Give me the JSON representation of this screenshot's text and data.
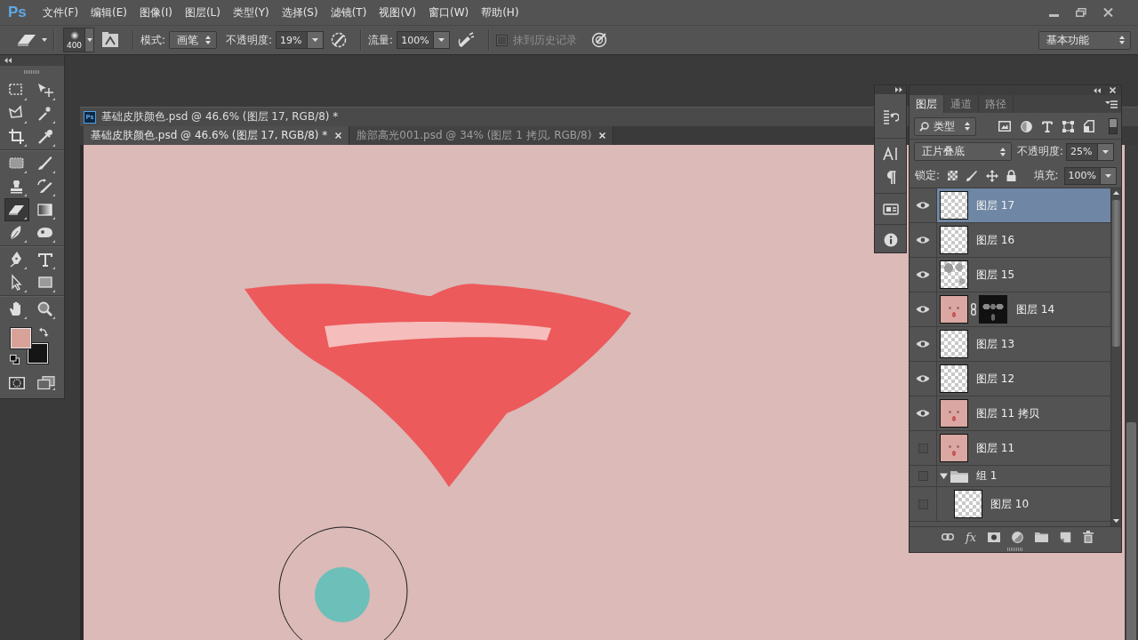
{
  "menu_bar": {
    "logo": "Ps",
    "items": [
      "文件(F)",
      "编辑(E)",
      "图像(I)",
      "图层(L)",
      "类型(Y)",
      "选择(S)",
      "滤镜(T)",
      "视图(V)",
      "窗口(W)",
      "帮助(H)"
    ]
  },
  "options_bar": {
    "brush_size": "400",
    "mode": {
      "label": "模式:",
      "value": "画笔"
    },
    "opacity": {
      "label": "不透明度:",
      "value": "19%"
    },
    "flow": {
      "label": "流量:",
      "value": "100%"
    },
    "erase_to_history": {
      "label": "抹到历史记录",
      "checked": false,
      "disabled": true
    },
    "workspace": "基本功能"
  },
  "tool_groups": [
    {
      "tools": [
        {
          "kind": "marquee",
          "selected": false
        },
        {
          "kind": "move",
          "selected": false
        },
        {
          "kind": "lasso",
          "selected": false
        },
        {
          "kind": "magic_wand",
          "selected": false
        },
        {
          "kind": "crop",
          "selected": false
        },
        {
          "kind": "eyedropper",
          "selected": false
        }
      ]
    },
    {
      "tools": [
        {
          "kind": "healing",
          "selected": false
        },
        {
          "kind": "brush",
          "selected": false
        },
        {
          "kind": "stamp",
          "selected": false
        },
        {
          "kind": "history_brush",
          "selected": false
        },
        {
          "kind": "eraser",
          "selected": true
        },
        {
          "kind": "gradient",
          "selected": false
        },
        {
          "kind": "blur",
          "selected": false
        },
        {
          "kind": "sponge",
          "selected": false
        }
      ]
    },
    {
      "tools": [
        {
          "kind": "pen",
          "selected": false
        },
        {
          "kind": "type",
          "selected": false
        },
        {
          "kind": "path_select",
          "selected": false
        },
        {
          "kind": "shape",
          "selected": false
        }
      ]
    },
    {
      "tools": [
        {
          "kind": "hand",
          "selected": false
        },
        {
          "kind": "zoom",
          "selected": false
        }
      ]
    }
  ],
  "swatches": [
    {
      "kind": "background",
      "color": "#151515"
    },
    {
      "kind": "foreground",
      "color": "#d9a299"
    }
  ],
  "document": {
    "icon": "Ps",
    "title": "基础皮肤颜色.psd @ 46.6% (图层 17, RGB/8) *",
    "tabs": [
      {
        "label": "基础皮肤颜色.psd @ 46.6% (图层 17, RGB/8) *",
        "selected": true
      },
      {
        "label": "脸部高光001.psd @ 34% (图层 1 拷贝, RGB/8)",
        "selected": false
      }
    ]
  },
  "layers_panel": {
    "tabs": [
      {
        "label": "图层",
        "selected": true
      },
      {
        "label": "通道",
        "selected": false
      },
      {
        "label": "路径",
        "selected": false
      }
    ],
    "filter": "类型",
    "filter_on": false,
    "blend_mode": "正片叠底",
    "opacity": {
      "label": "不透明度:",
      "value": "25%"
    },
    "lock_label": "锁定:",
    "fill": {
      "label": "填充:",
      "value": "100%"
    },
    "style_button": "fx",
    "layers": [
      {
        "kind": "layer",
        "name": "图层 17",
        "visible": true,
        "selected": true,
        "thumbnail": {
          "kind": "empty"
        }
      },
      {
        "kind": "layer",
        "name": "图层 16",
        "visible": true,
        "selected": false,
        "thumbnail": {
          "kind": "empty"
        }
      },
      {
        "kind": "layer",
        "name": "图层 15",
        "visible": true,
        "selected": false,
        "thumbnail": {
          "kind": "sparse"
        }
      },
      {
        "kind": "masked",
        "name": "图层 14",
        "visible": true,
        "selected": false,
        "thumbnail": {
          "kind": "face"
        }
      },
      {
        "kind": "layer",
        "name": "图层 13",
        "visible": true,
        "selected": false,
        "thumbnail": {
          "kind": "empty"
        }
      },
      {
        "kind": "layer",
        "name": "图层 12",
        "visible": true,
        "selected": false,
        "thumbnail": {
          "kind": "empty"
        }
      },
      {
        "kind": "layer",
        "name": "图层 11 拷贝",
        "visible": true,
        "selected": false,
        "thumbnail": {
          "kind": "face"
        }
      },
      {
        "kind": "layer",
        "name": "图层 11",
        "visible": false,
        "selected": false,
        "thumbnail": {
          "kind": "face"
        }
      },
      {
        "kind": "group",
        "name": "组 1",
        "visible": false,
        "selected": false,
        "expanded": true,
        "children": [
          {
            "kind": "layer",
            "name": "图层 10",
            "visible": false,
            "selected": false,
            "thumbnail": {
              "kind": "empty"
            }
          }
        ]
      }
    ]
  }
}
